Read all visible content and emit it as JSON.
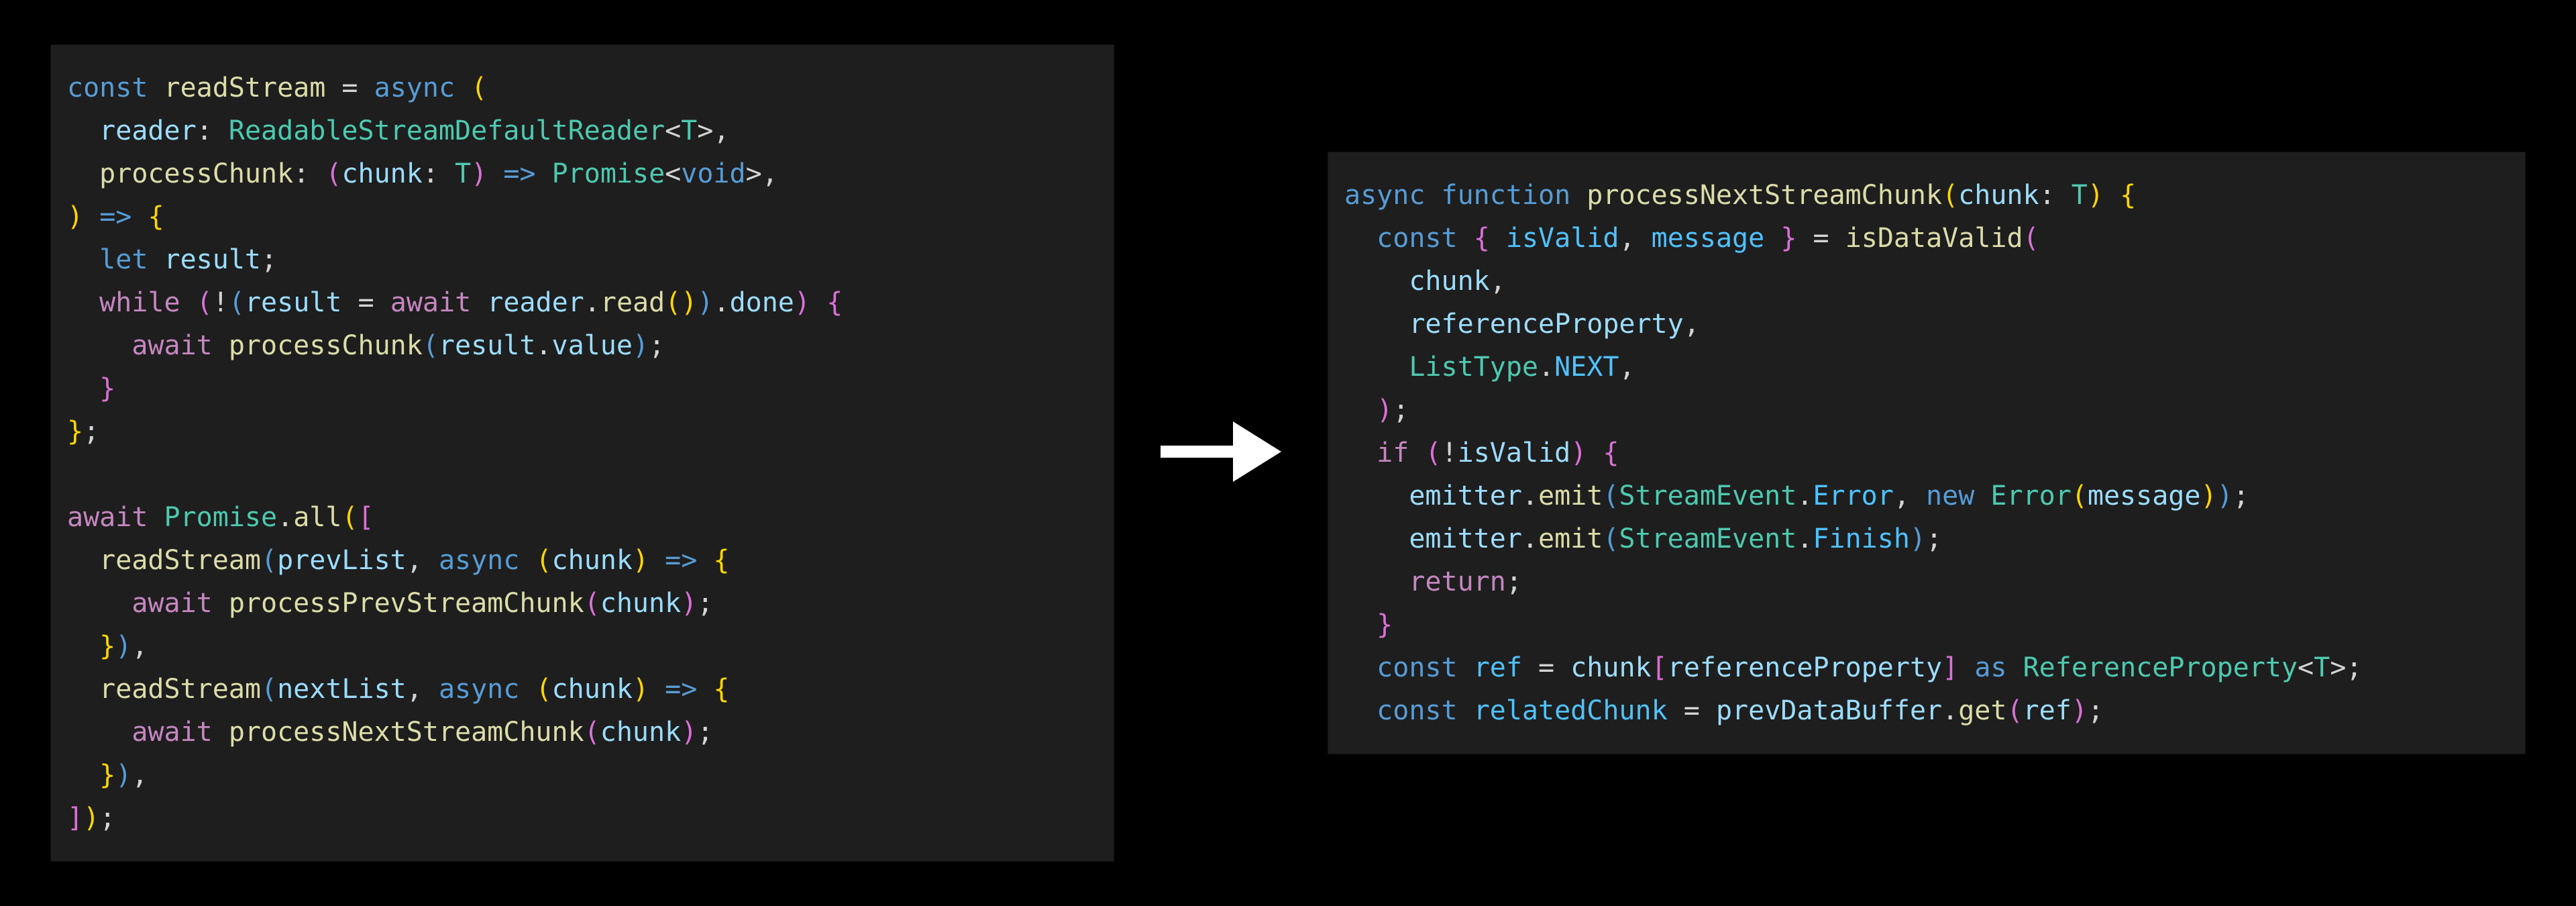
{
  "left_code": {
    "lines": [
      [
        {
          "t": "const ",
          "c": "tk-kw"
        },
        {
          "t": "readStream",
          "c": "tk-fn"
        },
        {
          "t": " ",
          "c": "tk-op"
        },
        {
          "t": "=",
          "c": "tk-op"
        },
        {
          "t": " ",
          "c": "tk-op"
        },
        {
          "t": "async",
          "c": "tk-kw"
        },
        {
          "t": " ",
          "c": "tk-op"
        },
        {
          "t": "(",
          "c": "tk-paren-y"
        }
      ],
      [
        {
          "t": "  ",
          "c": "tk-op"
        },
        {
          "t": "reader",
          "c": "tk-var"
        },
        {
          "t": ":",
          "c": "tk-punc"
        },
        {
          "t": " ",
          "c": "tk-op"
        },
        {
          "t": "ReadableStreamDefaultReader",
          "c": "tk-type"
        },
        {
          "t": "<",
          "c": "tk-punc"
        },
        {
          "t": "T",
          "c": "tk-type"
        },
        {
          "t": ">",
          "c": "tk-punc"
        },
        {
          "t": ",",
          "c": "tk-punc"
        }
      ],
      [
        {
          "t": "  ",
          "c": "tk-op"
        },
        {
          "t": "processChunk",
          "c": "tk-fn"
        },
        {
          "t": ":",
          "c": "tk-punc"
        },
        {
          "t": " ",
          "c": "tk-op"
        },
        {
          "t": "(",
          "c": "tk-paren-m"
        },
        {
          "t": "chunk",
          "c": "tk-var"
        },
        {
          "t": ":",
          "c": "tk-punc"
        },
        {
          "t": " ",
          "c": "tk-op"
        },
        {
          "t": "T",
          "c": "tk-type"
        },
        {
          "t": ")",
          "c": "tk-paren-m"
        },
        {
          "t": " ",
          "c": "tk-op"
        },
        {
          "t": "=>",
          "c": "tk-kw"
        },
        {
          "t": " ",
          "c": "tk-op"
        },
        {
          "t": "Promise",
          "c": "tk-type"
        },
        {
          "t": "<",
          "c": "tk-punc"
        },
        {
          "t": "void",
          "c": "tk-kw"
        },
        {
          "t": ">",
          "c": "tk-punc"
        },
        {
          "t": ",",
          "c": "tk-punc"
        }
      ],
      [
        {
          "t": ")",
          "c": "tk-paren-y"
        },
        {
          "t": " ",
          "c": "tk-op"
        },
        {
          "t": "=>",
          "c": "tk-kw"
        },
        {
          "t": " ",
          "c": "tk-op"
        },
        {
          "t": "{",
          "c": "tk-paren-y"
        }
      ],
      [
        {
          "t": "  ",
          "c": "tk-op"
        },
        {
          "t": "let",
          "c": "tk-kw"
        },
        {
          "t": " ",
          "c": "tk-op"
        },
        {
          "t": "result",
          "c": "tk-var"
        },
        {
          "t": ";",
          "c": "tk-punc"
        }
      ],
      [
        {
          "t": "  ",
          "c": "tk-op"
        },
        {
          "t": "while",
          "c": "tk-ctrl"
        },
        {
          "t": " ",
          "c": "tk-op"
        },
        {
          "t": "(",
          "c": "tk-paren-m"
        },
        {
          "t": "!",
          "c": "tk-op"
        },
        {
          "t": "(",
          "c": "tk-paren-b"
        },
        {
          "t": "result",
          "c": "tk-var"
        },
        {
          "t": " ",
          "c": "tk-op"
        },
        {
          "t": "=",
          "c": "tk-op"
        },
        {
          "t": " ",
          "c": "tk-op"
        },
        {
          "t": "await",
          "c": "tk-ctrl"
        },
        {
          "t": " ",
          "c": "tk-op"
        },
        {
          "t": "reader",
          "c": "tk-var"
        },
        {
          "t": ".",
          "c": "tk-punc"
        },
        {
          "t": "read",
          "c": "tk-fn"
        },
        {
          "t": "(",
          "c": "tk-paren-y"
        },
        {
          "t": ")",
          "c": "tk-paren-y"
        },
        {
          "t": ")",
          "c": "tk-paren-b"
        },
        {
          "t": ".",
          "c": "tk-punc"
        },
        {
          "t": "done",
          "c": "tk-prop"
        },
        {
          "t": ")",
          "c": "tk-paren-m"
        },
        {
          "t": " ",
          "c": "tk-op"
        },
        {
          "t": "{",
          "c": "tk-paren-m"
        }
      ],
      [
        {
          "t": "    ",
          "c": "tk-op"
        },
        {
          "t": "await",
          "c": "tk-ctrl"
        },
        {
          "t": " ",
          "c": "tk-op"
        },
        {
          "t": "processChunk",
          "c": "tk-fn"
        },
        {
          "t": "(",
          "c": "tk-paren-b"
        },
        {
          "t": "result",
          "c": "tk-var"
        },
        {
          "t": ".",
          "c": "tk-punc"
        },
        {
          "t": "value",
          "c": "tk-prop"
        },
        {
          "t": ")",
          "c": "tk-paren-b"
        },
        {
          "t": ";",
          "c": "tk-punc"
        }
      ],
      [
        {
          "t": "  ",
          "c": "tk-op"
        },
        {
          "t": "}",
          "c": "tk-paren-m"
        }
      ],
      [
        {
          "t": "}",
          "c": "tk-paren-y"
        },
        {
          "t": ";",
          "c": "tk-punc"
        }
      ],
      [
        {
          "t": " ",
          "c": "tk-op"
        }
      ],
      [
        {
          "t": "await",
          "c": "tk-ctrl"
        },
        {
          "t": " ",
          "c": "tk-op"
        },
        {
          "t": "Promise",
          "c": "tk-type"
        },
        {
          "t": ".",
          "c": "tk-punc"
        },
        {
          "t": "all",
          "c": "tk-fn"
        },
        {
          "t": "(",
          "c": "tk-paren-y"
        },
        {
          "t": "[",
          "c": "tk-paren-m"
        }
      ],
      [
        {
          "t": "  ",
          "c": "tk-op"
        },
        {
          "t": "readStream",
          "c": "tk-fn"
        },
        {
          "t": "(",
          "c": "tk-paren-b"
        },
        {
          "t": "prevList",
          "c": "tk-var"
        },
        {
          "t": ",",
          "c": "tk-punc"
        },
        {
          "t": " ",
          "c": "tk-op"
        },
        {
          "t": "async",
          "c": "tk-kw"
        },
        {
          "t": " ",
          "c": "tk-op"
        },
        {
          "t": "(",
          "c": "tk-paren-y"
        },
        {
          "t": "chunk",
          "c": "tk-var"
        },
        {
          "t": ")",
          "c": "tk-paren-y"
        },
        {
          "t": " ",
          "c": "tk-op"
        },
        {
          "t": "=>",
          "c": "tk-kw"
        },
        {
          "t": " ",
          "c": "tk-op"
        },
        {
          "t": "{",
          "c": "tk-paren-y"
        }
      ],
      [
        {
          "t": "    ",
          "c": "tk-op"
        },
        {
          "t": "await",
          "c": "tk-ctrl"
        },
        {
          "t": " ",
          "c": "tk-op"
        },
        {
          "t": "processPrevStreamChunk",
          "c": "tk-fn"
        },
        {
          "t": "(",
          "c": "tk-paren-m"
        },
        {
          "t": "chunk",
          "c": "tk-var"
        },
        {
          "t": ")",
          "c": "tk-paren-m"
        },
        {
          "t": ";",
          "c": "tk-punc"
        }
      ],
      [
        {
          "t": "  ",
          "c": "tk-op"
        },
        {
          "t": "}",
          "c": "tk-paren-y"
        },
        {
          "t": ")",
          "c": "tk-paren-b"
        },
        {
          "t": ",",
          "c": "tk-punc"
        }
      ],
      [
        {
          "t": "  ",
          "c": "tk-op"
        },
        {
          "t": "readStream",
          "c": "tk-fn"
        },
        {
          "t": "(",
          "c": "tk-paren-b"
        },
        {
          "t": "nextList",
          "c": "tk-var"
        },
        {
          "t": ",",
          "c": "tk-punc"
        },
        {
          "t": " ",
          "c": "tk-op"
        },
        {
          "t": "async",
          "c": "tk-kw"
        },
        {
          "t": " ",
          "c": "tk-op"
        },
        {
          "t": "(",
          "c": "tk-paren-y"
        },
        {
          "t": "chunk",
          "c": "tk-var"
        },
        {
          "t": ")",
          "c": "tk-paren-y"
        },
        {
          "t": " ",
          "c": "tk-op"
        },
        {
          "t": "=>",
          "c": "tk-kw"
        },
        {
          "t": " ",
          "c": "tk-op"
        },
        {
          "t": "{",
          "c": "tk-paren-y"
        }
      ],
      [
        {
          "t": "    ",
          "c": "tk-op"
        },
        {
          "t": "await",
          "c": "tk-ctrl"
        },
        {
          "t": " ",
          "c": "tk-op"
        },
        {
          "t": "processNextStreamChunk",
          "c": "tk-fn"
        },
        {
          "t": "(",
          "c": "tk-paren-m"
        },
        {
          "t": "chunk",
          "c": "tk-var"
        },
        {
          "t": ")",
          "c": "tk-paren-m"
        },
        {
          "t": ";",
          "c": "tk-punc"
        }
      ],
      [
        {
          "t": "  ",
          "c": "tk-op"
        },
        {
          "t": "}",
          "c": "tk-paren-y"
        },
        {
          "t": ")",
          "c": "tk-paren-b"
        },
        {
          "t": ",",
          "c": "tk-punc"
        }
      ],
      [
        {
          "t": "]",
          "c": "tk-paren-m"
        },
        {
          "t": ")",
          "c": "tk-paren-y"
        },
        {
          "t": ";",
          "c": "tk-punc"
        }
      ]
    ]
  },
  "right_code": {
    "lines": [
      [
        {
          "t": "async",
          "c": "tk-kw"
        },
        {
          "t": " ",
          "c": "tk-op"
        },
        {
          "t": "function",
          "c": "tk-kw"
        },
        {
          "t": " ",
          "c": "tk-op"
        },
        {
          "t": "processNextStreamChunk",
          "c": "tk-fn"
        },
        {
          "t": "(",
          "c": "tk-paren-y"
        },
        {
          "t": "chunk",
          "c": "tk-var"
        },
        {
          "t": ":",
          "c": "tk-punc"
        },
        {
          "t": " ",
          "c": "tk-op"
        },
        {
          "t": "T",
          "c": "tk-type"
        },
        {
          "t": ")",
          "c": "tk-paren-y"
        },
        {
          "t": " ",
          "c": "tk-op"
        },
        {
          "t": "{",
          "c": "tk-paren-y"
        }
      ],
      [
        {
          "t": "  ",
          "c": "tk-op"
        },
        {
          "t": "const",
          "c": "tk-kw"
        },
        {
          "t": " ",
          "c": "tk-op"
        },
        {
          "t": "{",
          "c": "tk-paren-m"
        },
        {
          "t": " ",
          "c": "tk-op"
        },
        {
          "t": "isValid",
          "c": "tk-const"
        },
        {
          "t": ",",
          "c": "tk-punc"
        },
        {
          "t": " ",
          "c": "tk-op"
        },
        {
          "t": "message",
          "c": "tk-const"
        },
        {
          "t": " ",
          "c": "tk-op"
        },
        {
          "t": "}",
          "c": "tk-paren-m"
        },
        {
          "t": " ",
          "c": "tk-op"
        },
        {
          "t": "=",
          "c": "tk-op"
        },
        {
          "t": " ",
          "c": "tk-op"
        },
        {
          "t": "isDataValid",
          "c": "tk-fn"
        },
        {
          "t": "(",
          "c": "tk-paren-m"
        }
      ],
      [
        {
          "t": "    ",
          "c": "tk-op"
        },
        {
          "t": "chunk",
          "c": "tk-var"
        },
        {
          "t": ",",
          "c": "tk-punc"
        }
      ],
      [
        {
          "t": "    ",
          "c": "tk-op"
        },
        {
          "t": "referenceProperty",
          "c": "tk-var"
        },
        {
          "t": ",",
          "c": "tk-punc"
        }
      ],
      [
        {
          "t": "    ",
          "c": "tk-op"
        },
        {
          "t": "ListType",
          "c": "tk-type"
        },
        {
          "t": ".",
          "c": "tk-punc"
        },
        {
          "t": "NEXT",
          "c": "tk-const"
        },
        {
          "t": ",",
          "c": "tk-punc"
        }
      ],
      [
        {
          "t": "  ",
          "c": "tk-op"
        },
        {
          "t": ")",
          "c": "tk-paren-m"
        },
        {
          "t": ";",
          "c": "tk-punc"
        }
      ],
      [
        {
          "t": "  ",
          "c": "tk-op"
        },
        {
          "t": "if",
          "c": "tk-ctrl"
        },
        {
          "t": " ",
          "c": "tk-op"
        },
        {
          "t": "(",
          "c": "tk-paren-m"
        },
        {
          "t": "!",
          "c": "tk-op"
        },
        {
          "t": "isValid",
          "c": "tk-var"
        },
        {
          "t": ")",
          "c": "tk-paren-m"
        },
        {
          "t": " ",
          "c": "tk-op"
        },
        {
          "t": "{",
          "c": "tk-paren-m"
        }
      ],
      [
        {
          "t": "    ",
          "c": "tk-op"
        },
        {
          "t": "emitter",
          "c": "tk-var"
        },
        {
          "t": ".",
          "c": "tk-punc"
        },
        {
          "t": "emit",
          "c": "tk-fn"
        },
        {
          "t": "(",
          "c": "tk-paren-b"
        },
        {
          "t": "StreamEvent",
          "c": "tk-type"
        },
        {
          "t": ".",
          "c": "tk-punc"
        },
        {
          "t": "Error",
          "c": "tk-const"
        },
        {
          "t": ",",
          "c": "tk-punc"
        },
        {
          "t": " ",
          "c": "tk-op"
        },
        {
          "t": "new",
          "c": "tk-kw"
        },
        {
          "t": " ",
          "c": "tk-op"
        },
        {
          "t": "Error",
          "c": "tk-type"
        },
        {
          "t": "(",
          "c": "tk-paren-y"
        },
        {
          "t": "message",
          "c": "tk-var"
        },
        {
          "t": ")",
          "c": "tk-paren-y"
        },
        {
          "t": ")",
          "c": "tk-paren-b"
        },
        {
          "t": ";",
          "c": "tk-punc"
        }
      ],
      [
        {
          "t": "    ",
          "c": "tk-op"
        },
        {
          "t": "emitter",
          "c": "tk-var"
        },
        {
          "t": ".",
          "c": "tk-punc"
        },
        {
          "t": "emit",
          "c": "tk-fn"
        },
        {
          "t": "(",
          "c": "tk-paren-b"
        },
        {
          "t": "StreamEvent",
          "c": "tk-type"
        },
        {
          "t": ".",
          "c": "tk-punc"
        },
        {
          "t": "Finish",
          "c": "tk-const"
        },
        {
          "t": ")",
          "c": "tk-paren-b"
        },
        {
          "t": ";",
          "c": "tk-punc"
        }
      ],
      [
        {
          "t": "    ",
          "c": "tk-op"
        },
        {
          "t": "return",
          "c": "tk-ctrl"
        },
        {
          "t": ";",
          "c": "tk-punc"
        }
      ],
      [
        {
          "t": "  ",
          "c": "tk-op"
        },
        {
          "t": "}",
          "c": "tk-paren-m"
        }
      ],
      [
        {
          "t": "  ",
          "c": "tk-op"
        },
        {
          "t": "const",
          "c": "tk-kw"
        },
        {
          "t": " ",
          "c": "tk-op"
        },
        {
          "t": "ref",
          "c": "tk-const"
        },
        {
          "t": " ",
          "c": "tk-op"
        },
        {
          "t": "=",
          "c": "tk-op"
        },
        {
          "t": " ",
          "c": "tk-op"
        },
        {
          "t": "chunk",
          "c": "tk-var"
        },
        {
          "t": "[",
          "c": "tk-paren-m"
        },
        {
          "t": "referenceProperty",
          "c": "tk-var"
        },
        {
          "t": "]",
          "c": "tk-paren-m"
        },
        {
          "t": " ",
          "c": "tk-op"
        },
        {
          "t": "as",
          "c": "tk-kw"
        },
        {
          "t": " ",
          "c": "tk-op"
        },
        {
          "t": "ReferenceProperty",
          "c": "tk-type"
        },
        {
          "t": "<",
          "c": "tk-punc"
        },
        {
          "t": "T",
          "c": "tk-type"
        },
        {
          "t": ">",
          "c": "tk-punc"
        },
        {
          "t": ";",
          "c": "tk-punc"
        }
      ],
      [
        {
          "t": "  ",
          "c": "tk-op"
        },
        {
          "t": "const",
          "c": "tk-kw"
        },
        {
          "t": " ",
          "c": "tk-op"
        },
        {
          "t": "relatedChunk",
          "c": "tk-const"
        },
        {
          "t": " ",
          "c": "tk-op"
        },
        {
          "t": "=",
          "c": "tk-op"
        },
        {
          "t": " ",
          "c": "tk-op"
        },
        {
          "t": "prevDataBuffer",
          "c": "tk-var"
        },
        {
          "t": ".",
          "c": "tk-punc"
        },
        {
          "t": "get",
          "c": "tk-fn"
        },
        {
          "t": "(",
          "c": "tk-paren-m"
        },
        {
          "t": "ref",
          "c": "tk-var"
        },
        {
          "t": ")",
          "c": "tk-paren-m"
        },
        {
          "t": ";",
          "c": "tk-punc"
        }
      ]
    ]
  }
}
